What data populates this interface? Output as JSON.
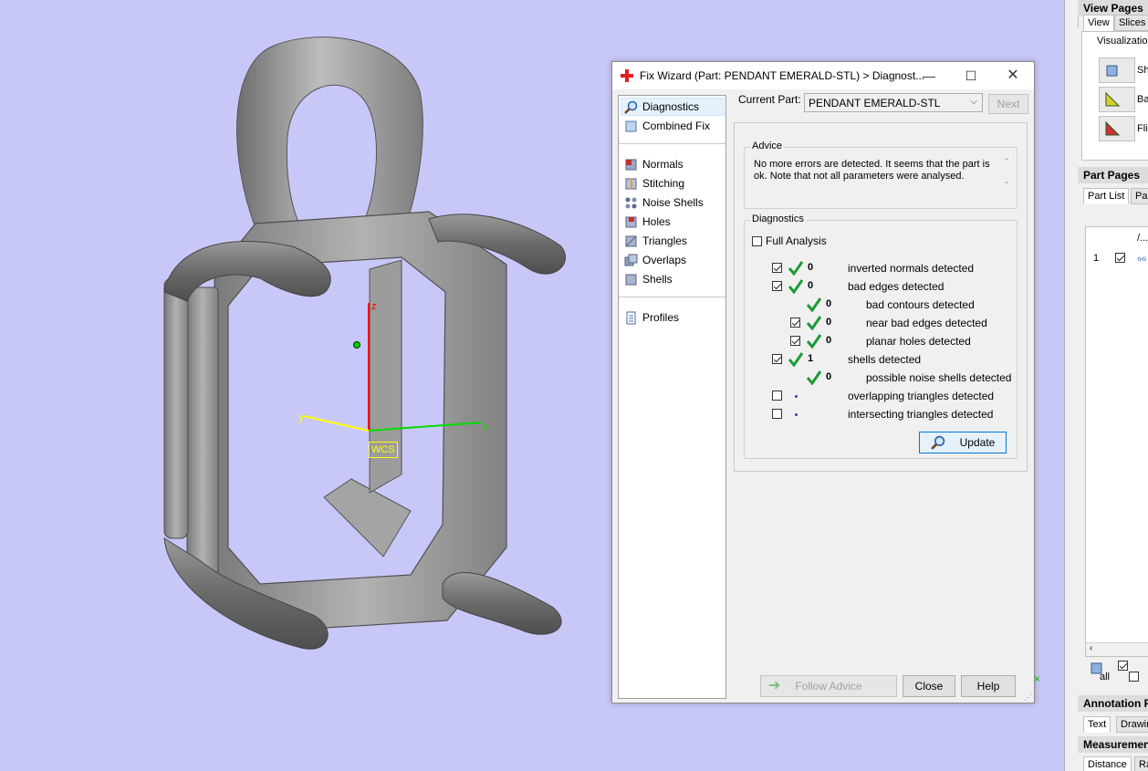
{
  "dialog": {
    "title": "Fix Wizard (Part: PENDANT EMERALD-STL) > Diagnost...",
    "nav": [
      {
        "label": "Diagnostics",
        "icon": "magnifier-icon"
      },
      {
        "label": "Combined Fix",
        "icon": "combined-fix-icon"
      },
      {
        "label": "Normals",
        "icon": "normals-icon"
      },
      {
        "label": "Stitching",
        "icon": "stitching-icon"
      },
      {
        "label": "Noise Shells",
        "icon": "noise-shells-icon"
      },
      {
        "label": "Holes",
        "icon": "holes-icon"
      },
      {
        "label": "Triangles",
        "icon": "triangles-icon"
      },
      {
        "label": "Overlaps",
        "icon": "overlaps-icon"
      },
      {
        "label": "Shells",
        "icon": "shells-icon"
      },
      {
        "label": "Profiles",
        "icon": "profiles-icon"
      }
    ],
    "current_part_label": "Current Part:",
    "current_part_value": "PENDANT EMERALD-STL",
    "next_label": "Next",
    "advice_title": "Advice",
    "advice_text": "No more errors are detected. It seems that the part is ok. Note that not all parameters were analysed.",
    "diagnostics_title": "Diagnostics",
    "full_analysis_label": "Full Analysis",
    "rows": [
      {
        "checkbox": true,
        "checked": true,
        "status": "ok",
        "count": "0",
        "label": "inverted normals detected"
      },
      {
        "checkbox": true,
        "checked": true,
        "status": "ok",
        "count": "0",
        "label": "bad edges detected"
      },
      {
        "checkbox": false,
        "checked": false,
        "status": "ok",
        "count": "0",
        "label": "bad contours detected"
      },
      {
        "checkbox": true,
        "checked": true,
        "status": "ok",
        "count": "0",
        "label": "near bad edges detected"
      },
      {
        "checkbox": true,
        "checked": true,
        "status": "ok",
        "count": "0",
        "label": "planar holes detected"
      },
      {
        "checkbox": true,
        "checked": true,
        "status": "ok",
        "count": "1",
        "label": "shells detected"
      },
      {
        "checkbox": false,
        "checked": false,
        "status": "ok",
        "count": "0",
        "label": "possible noise shells detected"
      },
      {
        "checkbox": true,
        "checked": false,
        "status": "pending",
        "count": "",
        "label": "overlapping triangles detected"
      },
      {
        "checkbox": true,
        "checked": false,
        "status": "pending",
        "count": "",
        "label": "intersecting triangles detected"
      }
    ],
    "update_label": "Update",
    "follow_advice_label": "Follow Advice",
    "close_label": "Close",
    "help_label": "Help"
  },
  "viewport": {
    "axis_z": "z",
    "axis_y": "y",
    "axis_x": "x",
    "wcs_label": "WCS"
  },
  "right_panel": {
    "view_pages": "View Pages",
    "tab_view": "View",
    "tab_slices": "Slices",
    "visualization": "Visualization",
    "btn1_label": "Sh",
    "btn2_label": "Ba",
    "btn3_label": "Fli",
    "part_pages": "Part Pages",
    "tab_part_list": "Part List",
    "tab_par": "Par",
    "col_header": "/...",
    "row1_num": "1",
    "all_label": "all",
    "annotation": "Annotation P",
    "tab_text": "Text",
    "tab_drawing": "Drawin",
    "measurement": "Measuremen",
    "tab_distance": "Distance",
    "tab_ra": "Ra"
  },
  "colors": {
    "viewport_bg": "#c8c8f8",
    "model": "#8c8c8c",
    "ok_check": "#1f9a3a"
  }
}
